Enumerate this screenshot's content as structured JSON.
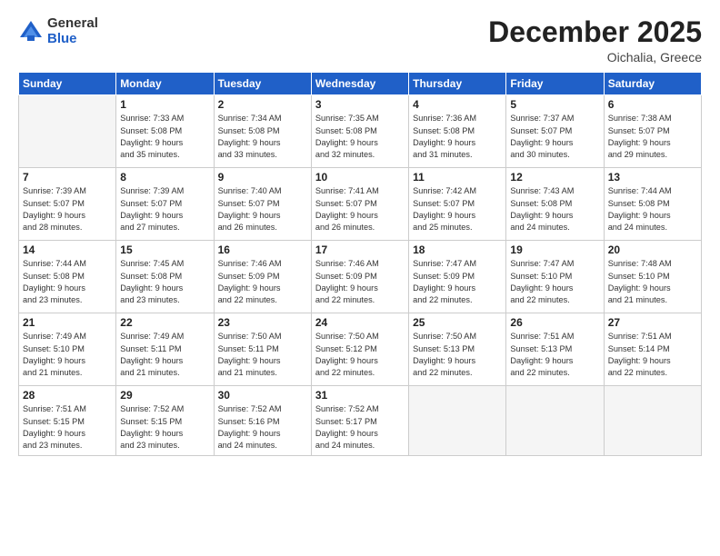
{
  "header": {
    "logo_general": "General",
    "logo_blue": "Blue",
    "month": "December 2025",
    "location": "Oichalia, Greece"
  },
  "weekdays": [
    "Sunday",
    "Monday",
    "Tuesday",
    "Wednesday",
    "Thursday",
    "Friday",
    "Saturday"
  ],
  "weeks": [
    [
      {
        "day": "",
        "info": ""
      },
      {
        "day": "1",
        "info": "Sunrise: 7:33 AM\nSunset: 5:08 PM\nDaylight: 9 hours\nand 35 minutes."
      },
      {
        "day": "2",
        "info": "Sunrise: 7:34 AM\nSunset: 5:08 PM\nDaylight: 9 hours\nand 33 minutes."
      },
      {
        "day": "3",
        "info": "Sunrise: 7:35 AM\nSunset: 5:08 PM\nDaylight: 9 hours\nand 32 minutes."
      },
      {
        "day": "4",
        "info": "Sunrise: 7:36 AM\nSunset: 5:08 PM\nDaylight: 9 hours\nand 31 minutes."
      },
      {
        "day": "5",
        "info": "Sunrise: 7:37 AM\nSunset: 5:07 PM\nDaylight: 9 hours\nand 30 minutes."
      },
      {
        "day": "6",
        "info": "Sunrise: 7:38 AM\nSunset: 5:07 PM\nDaylight: 9 hours\nand 29 minutes."
      }
    ],
    [
      {
        "day": "7",
        "info": "Sunrise: 7:39 AM\nSunset: 5:07 PM\nDaylight: 9 hours\nand 28 minutes."
      },
      {
        "day": "8",
        "info": "Sunrise: 7:39 AM\nSunset: 5:07 PM\nDaylight: 9 hours\nand 27 minutes."
      },
      {
        "day": "9",
        "info": "Sunrise: 7:40 AM\nSunset: 5:07 PM\nDaylight: 9 hours\nand 26 minutes."
      },
      {
        "day": "10",
        "info": "Sunrise: 7:41 AM\nSunset: 5:07 PM\nDaylight: 9 hours\nand 26 minutes."
      },
      {
        "day": "11",
        "info": "Sunrise: 7:42 AM\nSunset: 5:07 PM\nDaylight: 9 hours\nand 25 minutes."
      },
      {
        "day": "12",
        "info": "Sunrise: 7:43 AM\nSunset: 5:08 PM\nDaylight: 9 hours\nand 24 minutes."
      },
      {
        "day": "13",
        "info": "Sunrise: 7:44 AM\nSunset: 5:08 PM\nDaylight: 9 hours\nand 24 minutes."
      }
    ],
    [
      {
        "day": "14",
        "info": "Sunrise: 7:44 AM\nSunset: 5:08 PM\nDaylight: 9 hours\nand 23 minutes."
      },
      {
        "day": "15",
        "info": "Sunrise: 7:45 AM\nSunset: 5:08 PM\nDaylight: 9 hours\nand 23 minutes."
      },
      {
        "day": "16",
        "info": "Sunrise: 7:46 AM\nSunset: 5:09 PM\nDaylight: 9 hours\nand 22 minutes."
      },
      {
        "day": "17",
        "info": "Sunrise: 7:46 AM\nSunset: 5:09 PM\nDaylight: 9 hours\nand 22 minutes."
      },
      {
        "day": "18",
        "info": "Sunrise: 7:47 AM\nSunset: 5:09 PM\nDaylight: 9 hours\nand 22 minutes."
      },
      {
        "day": "19",
        "info": "Sunrise: 7:47 AM\nSunset: 5:10 PM\nDaylight: 9 hours\nand 22 minutes."
      },
      {
        "day": "20",
        "info": "Sunrise: 7:48 AM\nSunset: 5:10 PM\nDaylight: 9 hours\nand 21 minutes."
      }
    ],
    [
      {
        "day": "21",
        "info": "Sunrise: 7:49 AM\nSunset: 5:10 PM\nDaylight: 9 hours\nand 21 minutes."
      },
      {
        "day": "22",
        "info": "Sunrise: 7:49 AM\nSunset: 5:11 PM\nDaylight: 9 hours\nand 21 minutes."
      },
      {
        "day": "23",
        "info": "Sunrise: 7:50 AM\nSunset: 5:11 PM\nDaylight: 9 hours\nand 21 minutes."
      },
      {
        "day": "24",
        "info": "Sunrise: 7:50 AM\nSunset: 5:12 PM\nDaylight: 9 hours\nand 22 minutes."
      },
      {
        "day": "25",
        "info": "Sunrise: 7:50 AM\nSunset: 5:13 PM\nDaylight: 9 hours\nand 22 minutes."
      },
      {
        "day": "26",
        "info": "Sunrise: 7:51 AM\nSunset: 5:13 PM\nDaylight: 9 hours\nand 22 minutes."
      },
      {
        "day": "27",
        "info": "Sunrise: 7:51 AM\nSunset: 5:14 PM\nDaylight: 9 hours\nand 22 minutes."
      }
    ],
    [
      {
        "day": "28",
        "info": "Sunrise: 7:51 AM\nSunset: 5:15 PM\nDaylight: 9 hours\nand 23 minutes."
      },
      {
        "day": "29",
        "info": "Sunrise: 7:52 AM\nSunset: 5:15 PM\nDaylight: 9 hours\nand 23 minutes."
      },
      {
        "day": "30",
        "info": "Sunrise: 7:52 AM\nSunset: 5:16 PM\nDaylight: 9 hours\nand 24 minutes."
      },
      {
        "day": "31",
        "info": "Sunrise: 7:52 AM\nSunset: 5:17 PM\nDaylight: 9 hours\nand 24 minutes."
      },
      {
        "day": "",
        "info": ""
      },
      {
        "day": "",
        "info": ""
      },
      {
        "day": "",
        "info": ""
      }
    ]
  ]
}
